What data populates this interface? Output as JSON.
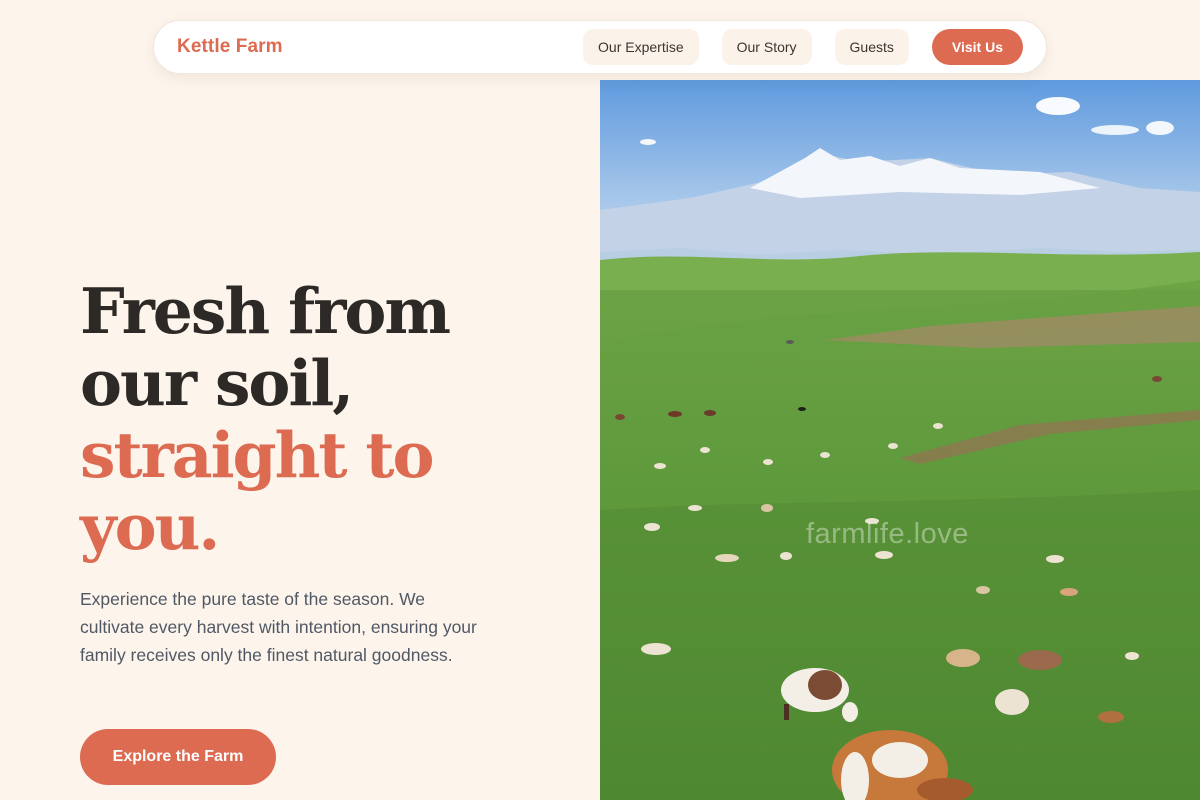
{
  "nav": {
    "brand": "Kettle Farm",
    "links": [
      {
        "label": "Our Expertise"
      },
      {
        "label": "Our Story"
      },
      {
        "label": "Guests"
      }
    ],
    "cta": "Visit Us"
  },
  "hero": {
    "title_lines": [
      "Fresh from",
      "our soil,"
    ],
    "title_accent_lines": [
      "straight to",
      "you."
    ],
    "description": "Experience the pure taste of the season. We cultivate every harvest with intention, ensuring your family receives only the finest natural goodness.",
    "button_label": "Explore the Farm"
  },
  "image": {
    "watermark": "farmlife.love"
  },
  "colors": {
    "accent": "#dc6b52",
    "background": "#fdf5ec",
    "heading": "#2c2926",
    "body_text": "#4f5864"
  }
}
